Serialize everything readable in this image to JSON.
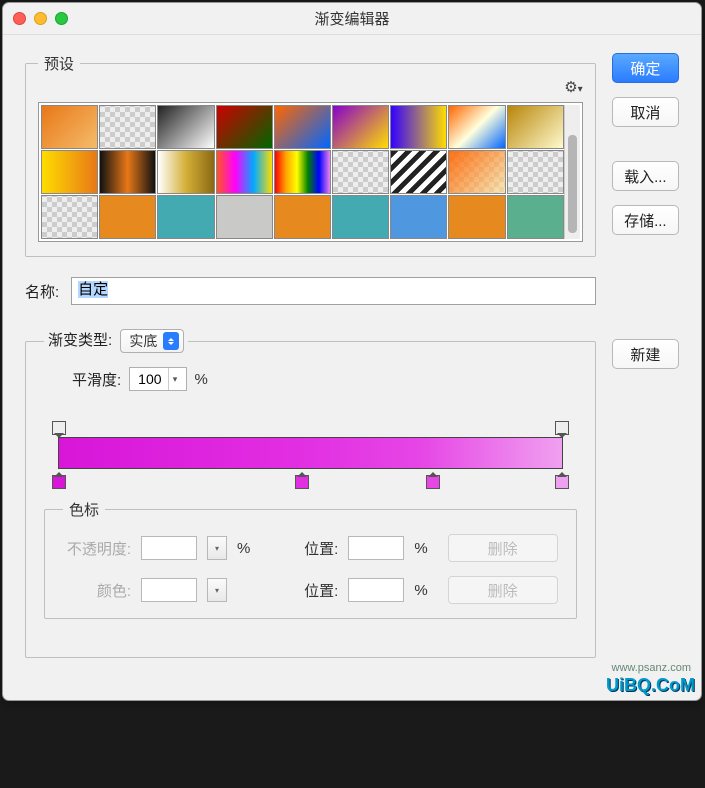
{
  "window": {
    "title": "渐变编辑器"
  },
  "buttons": {
    "ok": "确定",
    "cancel": "取消",
    "load": "载入...",
    "save": "存储...",
    "new": "新建",
    "delete": "删除"
  },
  "presets": {
    "legend": "预设",
    "gear": "✿."
  },
  "name": {
    "label": "名称:",
    "value": "自定"
  },
  "gradient": {
    "type_label": "渐变类型:",
    "type_value": "实底",
    "smooth_label": "平滑度:",
    "smooth_value": "100",
    "percent": "%",
    "stops_top": [
      {
        "pos": 0,
        "opacity": 100
      },
      {
        "pos": 100,
        "opacity": 100
      }
    ],
    "stops_bottom": [
      {
        "pos": 0,
        "color": "#d816d8"
      },
      {
        "pos": 47,
        "color": "#e22ee2"
      },
      {
        "pos": 72,
        "color": "#e646e6"
      },
      {
        "pos": 100,
        "color": "#f0a0f0"
      }
    ]
  },
  "color_stops": {
    "legend": "色标",
    "opacity_label": "不透明度:",
    "location_label": "位置:",
    "color_label": "颜色:",
    "opacity_value": "",
    "location_value": "",
    "color_value": ""
  },
  "watermark": "UiBQ.CoM",
  "watermark2": "www.psanz.com"
}
